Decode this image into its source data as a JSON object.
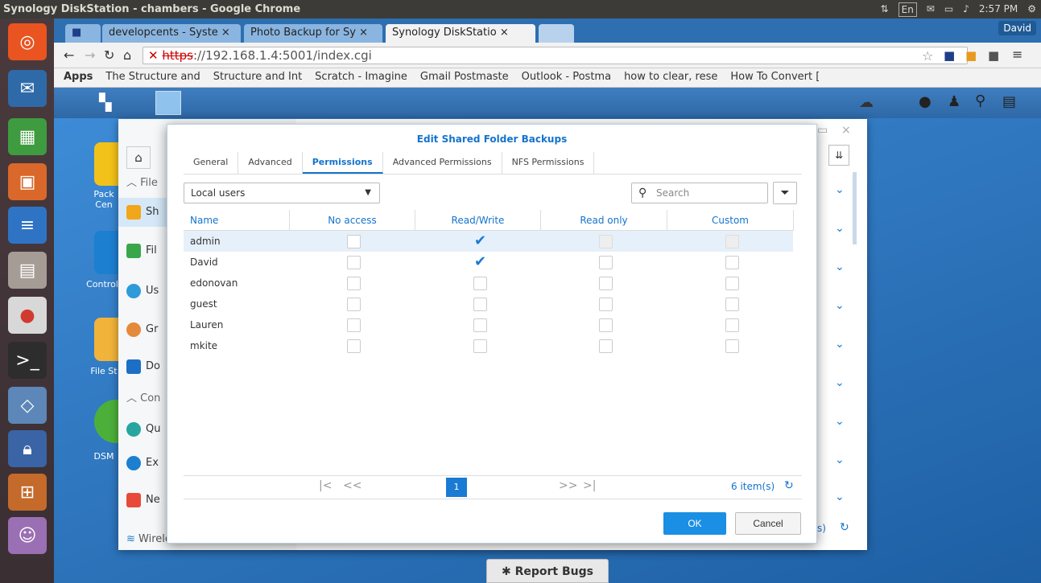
{
  "os": {
    "window_title": "Synology DiskStation - chambers - Google Chrome",
    "tray_lang": "En",
    "tray_time": "2:57 PM"
  },
  "chrome": {
    "tabs": [
      {
        "label": ""
      },
      {
        "label": "developcents - Syste"
      },
      {
        "label": "Photo Backup for Sy"
      },
      {
        "label": "Synology DiskStatio"
      }
    ],
    "user": "David",
    "url_scheme": "https",
    "url_rest": "://192.168.1.4:5001/index.cgi",
    "bookmarks": [
      "Apps",
      "The Structure and",
      "Structure and Int",
      "Scratch - Imagine",
      "Gmail Postmaste",
      "Outlook - Postma",
      "how to clear, rese",
      "How To Convert ["
    ]
  },
  "desktop": {
    "icons": [
      "Pack Cen",
      "Control",
      "File St",
      "DSM"
    ],
    "report_bugs": "Report Bugs"
  },
  "control_panel": {
    "sections": [
      {
        "label": "File"
      },
      {
        "label": "Con"
      }
    ],
    "items": [
      {
        "label": "Sh"
      },
      {
        "label": "Fil"
      },
      {
        "label": "Us"
      },
      {
        "label": "Gr"
      },
      {
        "label": "Do"
      },
      {
        "label": "Qu"
      },
      {
        "label": "Ex"
      },
      {
        "label": "Ne"
      },
      {
        "label": "Wireless"
      }
    ],
    "footer_text": "s)"
  },
  "dialog": {
    "title": "Edit Shared Folder Backups",
    "tabs": [
      "General",
      "Advanced",
      "Permissions",
      "Advanced Permissions",
      "NFS Permissions"
    ],
    "active_tab": "Permissions",
    "user_filter": "Local users",
    "search_placeholder": "Search",
    "columns": [
      "Name",
      "No access",
      "Read/Write",
      "Read only",
      "Custom"
    ],
    "rows": [
      {
        "name": "admin",
        "no_access": false,
        "read_write": true,
        "read_only": false,
        "custom": false,
        "disabled_ro_custom": true
      },
      {
        "name": "David",
        "no_access": false,
        "read_write": true,
        "read_only": false,
        "custom": false
      },
      {
        "name": "edonovan",
        "no_access": false,
        "read_write": false,
        "read_only": false,
        "custom": false
      },
      {
        "name": "guest",
        "no_access": false,
        "read_write": false,
        "read_only": false,
        "custom": false
      },
      {
        "name": "Lauren",
        "no_access": false,
        "read_write": false,
        "read_only": false,
        "custom": false
      },
      {
        "name": "mkite",
        "no_access": false,
        "read_write": false,
        "read_only": false,
        "custom": false
      }
    ],
    "pager": {
      "first": "|<",
      "prev": "<<",
      "page": "1",
      "next": ">>",
      "last": ">|",
      "count": "6 item(s)"
    },
    "ok": "OK",
    "cancel": "Cancel"
  }
}
